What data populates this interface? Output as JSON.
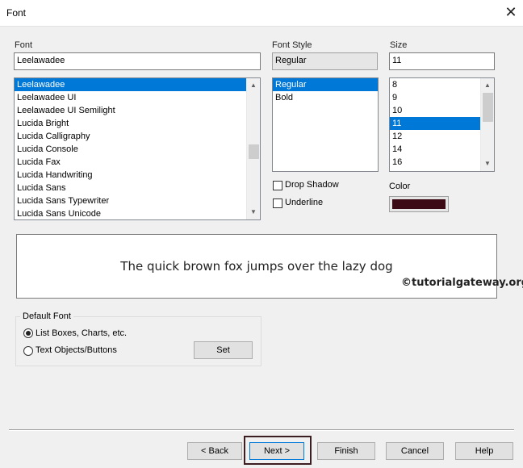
{
  "window": {
    "title": "Font",
    "close_symbol": "✕"
  },
  "font": {
    "label": "Font",
    "value": "Leelawadee",
    "items": [
      "Leelawadee",
      "Leelawadee UI",
      "Leelawadee UI Semilight",
      "Lucida Bright",
      "Lucida Calligraphy",
      "Lucida Console",
      "Lucida Fax",
      "Lucida Handwriting",
      "Lucida Sans",
      "Lucida Sans Typewriter",
      "Lucida Sans Unicode"
    ],
    "selected": "Leelawadee"
  },
  "font_style": {
    "label": "Font Style",
    "value": "Regular",
    "items": [
      "Regular",
      "Bold"
    ],
    "selected": "Regular"
  },
  "size": {
    "label": "Size",
    "value": "11",
    "items": [
      "8",
      "9",
      "10",
      "11",
      "12",
      "14",
      "16"
    ],
    "selected": "11"
  },
  "effects": {
    "drop_shadow": {
      "label": "Drop Shadow",
      "checked": false
    },
    "underline": {
      "label": "Underline",
      "checked": false
    }
  },
  "color": {
    "label": "Color",
    "value": "#3c0a14"
  },
  "preview": {
    "text": "The quick brown fox jumps over the lazy dog",
    "watermark": "©tutorialgateway.org"
  },
  "default_font": {
    "label": "Default Font",
    "options": [
      {
        "label": "List Boxes, Charts, etc.",
        "selected": true
      },
      {
        "label": "Text Objects/Buttons",
        "selected": false
      }
    ],
    "set_label": "Set"
  },
  "buttons": {
    "back": "< Back",
    "next": "Next >",
    "finish": "Finish",
    "cancel": "Cancel",
    "help": "Help"
  },
  "colors": {
    "selection": "#0078d7",
    "highlight_box": "#3c1e22"
  }
}
